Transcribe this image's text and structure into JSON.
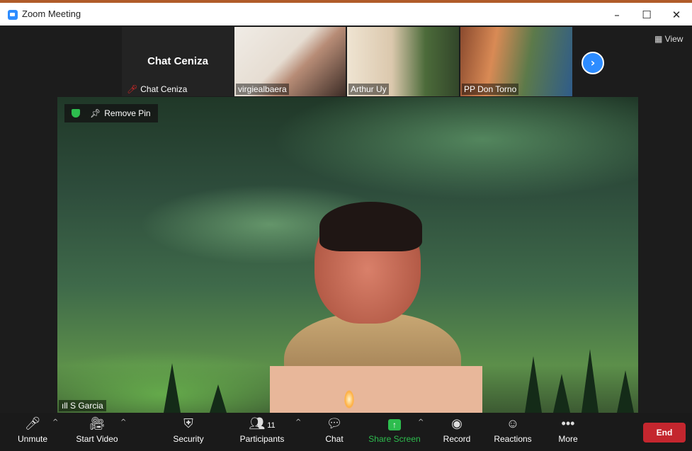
{
  "window": {
    "title": "Zoom Meeting",
    "minimize": "–",
    "maximize": "☐",
    "close": "✕"
  },
  "gallery": {
    "view_label": "View",
    "tiles": [
      {
        "big_name": "Chat Ceniza",
        "label": "Chat Ceniza"
      },
      {
        "label": "virgiealbaera"
      },
      {
        "label": "Arthur Uy"
      },
      {
        "label": "PP Don Torno"
      }
    ]
  },
  "pinned": {
    "pin_label": "Remove Pin",
    "speaker_name": "S Garcia"
  },
  "toolbar": {
    "unmute": "Unmute",
    "start_video": "Start Video",
    "security": "Security",
    "participants": "Participants",
    "participant_count": "11",
    "chat": "Chat",
    "share_screen": "Share Screen",
    "record": "Record",
    "reactions": "Reactions",
    "more": "More",
    "end": "End"
  },
  "colors": {
    "accent": "#2d8cff",
    "share": "#2dbd4e",
    "end": "#c4262e"
  }
}
